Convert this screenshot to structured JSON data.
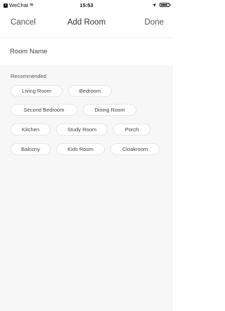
{
  "status_bar": {
    "back_app": "WeChat",
    "time": "15:53",
    "icons": [
      "back-app-icon",
      "wifi-icon",
      "location-icon",
      "battery-icon"
    ]
  },
  "nav": {
    "cancel": "Cancel",
    "title": "Add Room",
    "done": "Done"
  },
  "name_field": {
    "placeholder": "Room Name",
    "value": ""
  },
  "recommended": {
    "label": "Recommended",
    "rows": [
      [
        "Living Room",
        "Bedroom"
      ],
      [
        "Second Bedroom",
        "Dining Room"
      ],
      [
        "Kitchen",
        "Study Room",
        "Porch"
      ],
      [
        "Balcony",
        "Kids Room",
        "Cloakroom"
      ]
    ]
  },
  "colors": {
    "background": "#ffffff",
    "panel": "#f7f7f7",
    "chip_bg": "#ffffff",
    "text": "#333333"
  }
}
